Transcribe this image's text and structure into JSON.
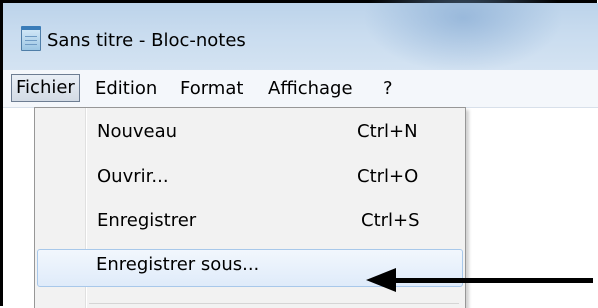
{
  "window": {
    "title": "Sans titre - Bloc-notes",
    "icon": "notepad-icon"
  },
  "menubar": {
    "items": [
      {
        "label": "Fichier",
        "active": true
      },
      {
        "label": "Edition"
      },
      {
        "label": "Format"
      },
      {
        "label": "Affichage"
      },
      {
        "label": "?"
      }
    ]
  },
  "file_menu": {
    "items": [
      {
        "label": "Nouveau",
        "shortcut": "Ctrl+N"
      },
      {
        "label": "Ouvrir...",
        "shortcut": "Ctrl+O"
      },
      {
        "label": "Enregistrer",
        "shortcut": "Ctrl+S"
      },
      {
        "label": "Enregistrer sous...",
        "shortcut": "",
        "highlighted": true
      }
    ]
  },
  "annotation": {
    "arrow": "arrow-left",
    "color": "#000000"
  }
}
